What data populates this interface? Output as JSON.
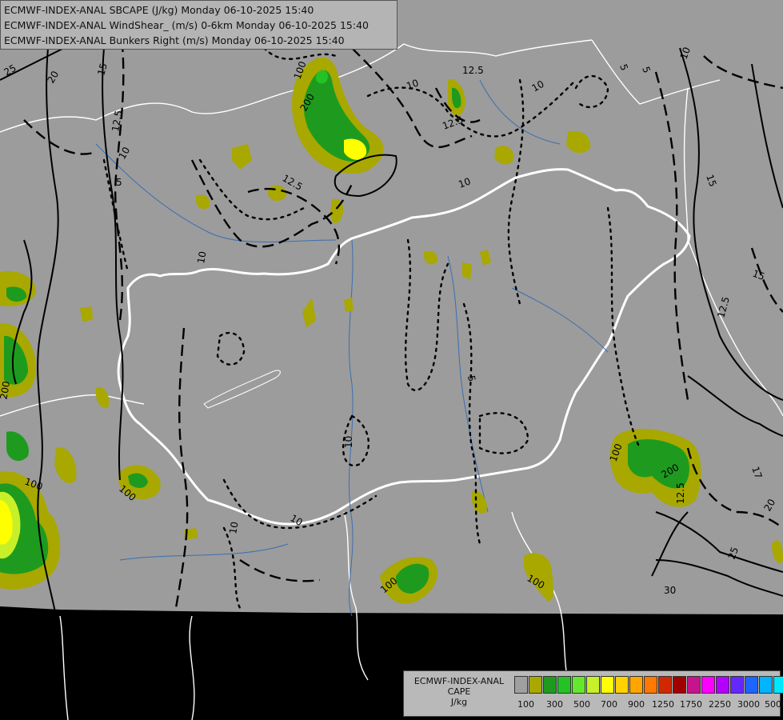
{
  "header": {
    "lines": [
      "ECMWF-INDEX-ANAL SBCAPE (J/kg) Monday 06-10-2025 15:40",
      "ECMWF-INDEX-ANAL WindShear_ (m/s) 0-6km Monday 06-10-2025 15:40",
      "ECMWF-INDEX-ANAL Bunkers Right (m/s) Monday 06-10-2025 15:40"
    ]
  },
  "legend": {
    "title_lines": [
      "ECMWF-INDEX-ANAL",
      "CAPE",
      "J/kg"
    ],
    "colors": [
      "#a0a0a0",
      "#a8a800",
      "#1e9b1e",
      "#24c224",
      "#64e82c",
      "#c8f028",
      "#ffff00",
      "#ffd200",
      "#ffa500",
      "#ff7800",
      "#d22800",
      "#a00000",
      "#c8148c",
      "#ff00ff",
      "#b400ff",
      "#6428ff",
      "#1e64ff",
      "#00b4ff",
      "#00e6ff",
      "#64ffff",
      "#ffffff"
    ],
    "tick_labels": [
      "100",
      "300",
      "500",
      "700",
      "900",
      "1250",
      "1750",
      "2250",
      "3000",
      "5000"
    ]
  },
  "map": {
    "colors": {
      "background": "#000000",
      "field": "#9c9c9c",
      "border": "#ffffff",
      "river": "#3a6fb0",
      "contour": "#000000",
      "cape_low": "#a8a800",
      "cape_mid": "#24c224",
      "cape_high": "#ffff00"
    },
    "contour_labels": [
      "25",
      "20",
      "15",
      "12.5",
      "10",
      "5",
      "100",
      "200",
      "12.5",
      "10",
      "12.5",
      "10",
      "5",
      "10",
      "12.5",
      "15",
      "15",
      "12.5",
      "10",
      "5",
      "10",
      "5",
      "100",
      "200",
      "12.5",
      "17",
      "20",
      "25",
      "30",
      "100",
      "100",
      "100",
      "100",
      "200",
      "10",
      "10",
      "10"
    ]
  }
}
